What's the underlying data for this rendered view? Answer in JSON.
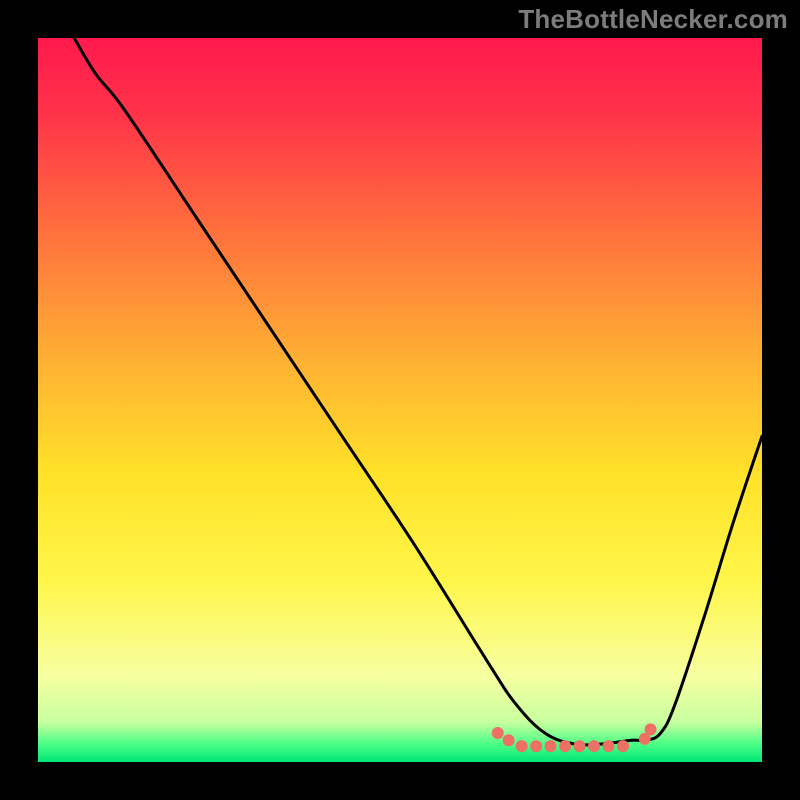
{
  "watermark": "TheBottleNecker.com",
  "chart_data": {
    "type": "line",
    "title": "",
    "xlabel": "",
    "ylabel": "",
    "xlim": [
      0,
      100
    ],
    "ylim": [
      0,
      100
    ],
    "series": [
      {
        "name": "curve",
        "color": "#000000",
        "x": [
          5,
          8,
          12,
          22,
          32,
          42,
          52,
          62,
          66,
          70,
          74,
          78,
          82,
          84,
          86,
          88,
          92,
          96,
          100
        ],
        "y": [
          100,
          95,
          90,
          75,
          60,
          45,
          30,
          14,
          8,
          4,
          2.5,
          2.5,
          3,
          3,
          4,
          8,
          20,
          33,
          45
        ]
      }
    ],
    "bottom_dots": {
      "color": "#ec7063",
      "radius": 6,
      "points": [
        {
          "x": 63.5,
          "y": 4.0
        },
        {
          "x": 65.0,
          "y": 3.0
        },
        {
          "x": 66.8,
          "y": 2.2
        },
        {
          "x": 68.8,
          "y": 2.2
        },
        {
          "x": 70.8,
          "y": 2.2
        },
        {
          "x": 72.8,
          "y": 2.2
        },
        {
          "x": 74.8,
          "y": 2.2
        },
        {
          "x": 76.8,
          "y": 2.2
        },
        {
          "x": 78.8,
          "y": 2.2
        },
        {
          "x": 80.8,
          "y": 2.2
        },
        {
          "x": 83.8,
          "y": 3.2
        },
        {
          "x": 84.6,
          "y": 4.5
        }
      ]
    },
    "gradient_stops": [
      {
        "offset": 0.0,
        "color": "#ff1a4d"
      },
      {
        "offset": 0.1,
        "color": "#ff3149"
      },
      {
        "offset": 0.25,
        "color": "#ff6a3e"
      },
      {
        "offset": 0.45,
        "color": "#ffb233"
      },
      {
        "offset": 0.6,
        "color": "#ffe128"
      },
      {
        "offset": 0.75,
        "color": "#fff64a"
      },
      {
        "offset": 0.88,
        "color": "#f7ffa0"
      },
      {
        "offset": 0.945,
        "color": "#c8ff9f"
      },
      {
        "offset": 0.975,
        "color": "#4cff86"
      },
      {
        "offset": 1.0,
        "color": "#00e676"
      }
    ]
  }
}
